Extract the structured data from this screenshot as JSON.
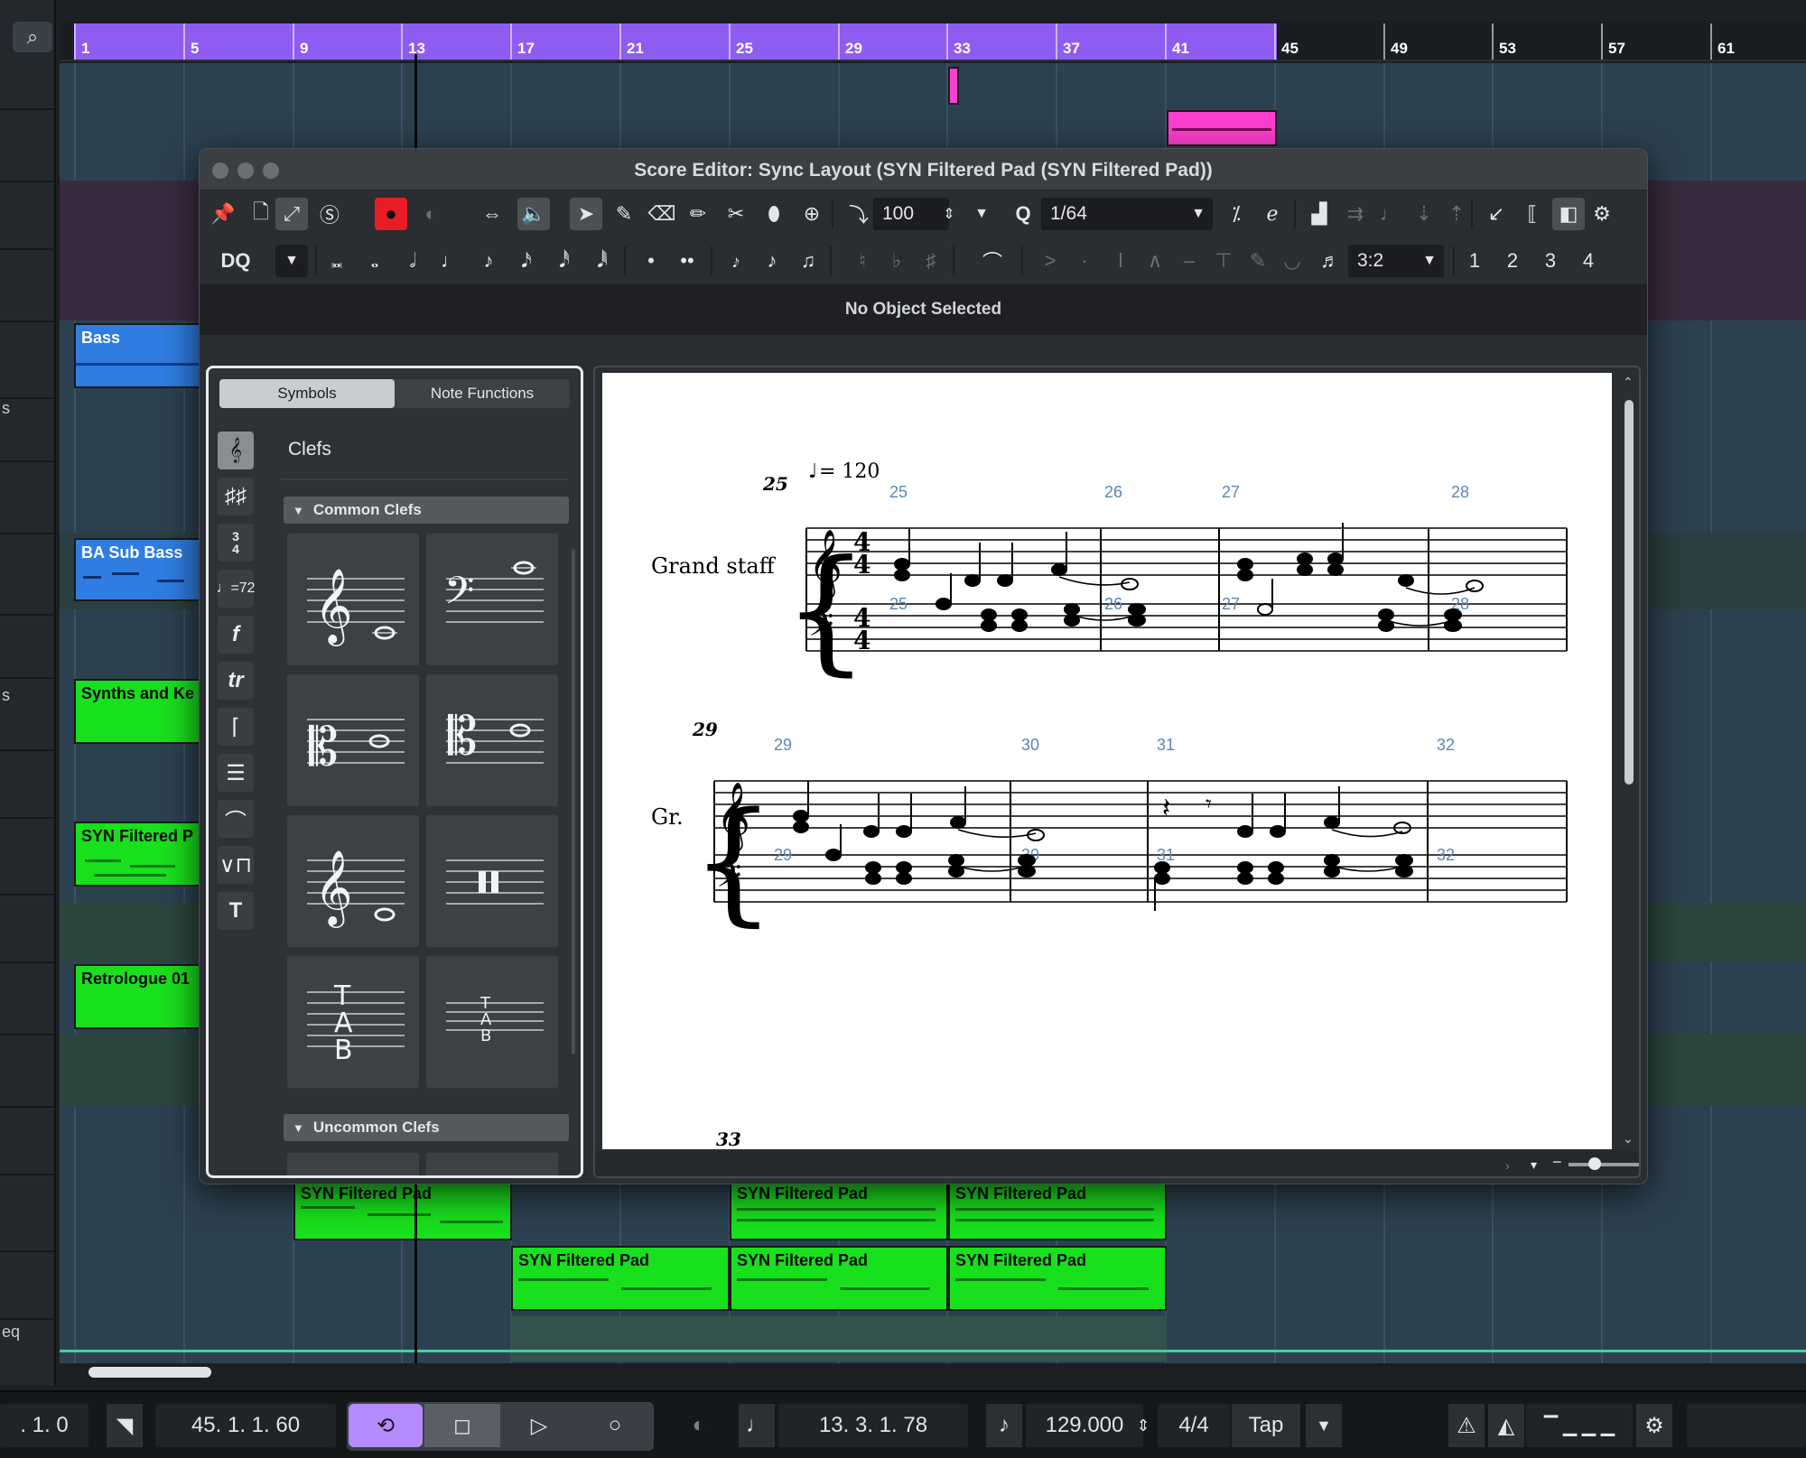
{
  "ruler": {
    "bars": [
      "1",
      "5",
      "9",
      "13",
      "17",
      "21",
      "25",
      "29",
      "33",
      "37",
      "41",
      "45",
      "49",
      "53",
      "57",
      "61"
    ]
  },
  "left_strip": {
    "search_icon": "search-icon",
    "channel_labels": [
      "s",
      "s",
      "eq"
    ]
  },
  "tracks": {
    "clips": [
      {
        "label": "Bass",
        "color": "#2f7de1"
      },
      {
        "label": "BA Sub Bass",
        "color": "#2f7de1"
      },
      {
        "label": "Synths and Ke",
        "color": "#19e01d"
      },
      {
        "label": "SYN Filtered P",
        "color": "#19e01d"
      },
      {
        "label": "Retrologue 01",
        "color": "#19e01d"
      },
      {
        "label": "SYN Filtered Pad",
        "color": "#19e01d"
      },
      {
        "label": "SYN Filtered Pad",
        "color": "#19e01d"
      },
      {
        "label": "SYN Filtered Pad",
        "color": "#19e01d"
      },
      {
        "label": "SYN Filtered Pad",
        "color": "#19e01d"
      },
      {
        "label": "SYN Filtered Pad",
        "color": "#19e01d"
      },
      {
        "label": "SYN Filtered Pad",
        "color": "#19e01d"
      },
      {
        "label": "SYN Filtered Pad",
        "color": "#19e01d"
      }
    ]
  },
  "score_editor": {
    "title": "Score Editor: Sync Layout (SYN Filtered Pad (SYN Filtered Pad))",
    "velocity": "100",
    "quantize_label": "Q",
    "quantize": "1/64",
    "display_quantize": "DQ",
    "tuplet": "3:2",
    "voices": [
      "1",
      "2",
      "3",
      "4"
    ],
    "info_line": "No Object Selected",
    "symbols_panel": {
      "tabs": [
        "Symbols",
        "Note Functions"
      ],
      "active_tab": "Symbols",
      "heading": "Clefs",
      "group_common": "Common Clefs",
      "group_uncommon": "Uncommon Clefs",
      "tab_letters_large": [
        "T",
        "A",
        "B"
      ],
      "tab_letters_small": [
        "T",
        "A",
        "B"
      ]
    },
    "score": {
      "tempo": "= 120",
      "systems": [
        {
          "system_number": "25",
          "staff_name": "Grand staff",
          "measure_numbers": [
            "25",
            "26",
            "27",
            "28"
          ],
          "time_signature": [
            "4",
            "4"
          ]
        },
        {
          "system_number": "29",
          "staff_name": "Gr.",
          "measure_numbers": [
            "29",
            "30",
            "31",
            "32"
          ]
        }
      ],
      "next_system_number": "33"
    }
  },
  "transport": {
    "left_locator": ". 1.    0",
    "right_locator": "45.  1.  1.  60",
    "position": "13.  3.  1.  78",
    "tempo": "129.000",
    "signature": "4/4",
    "tap": "Tap"
  }
}
